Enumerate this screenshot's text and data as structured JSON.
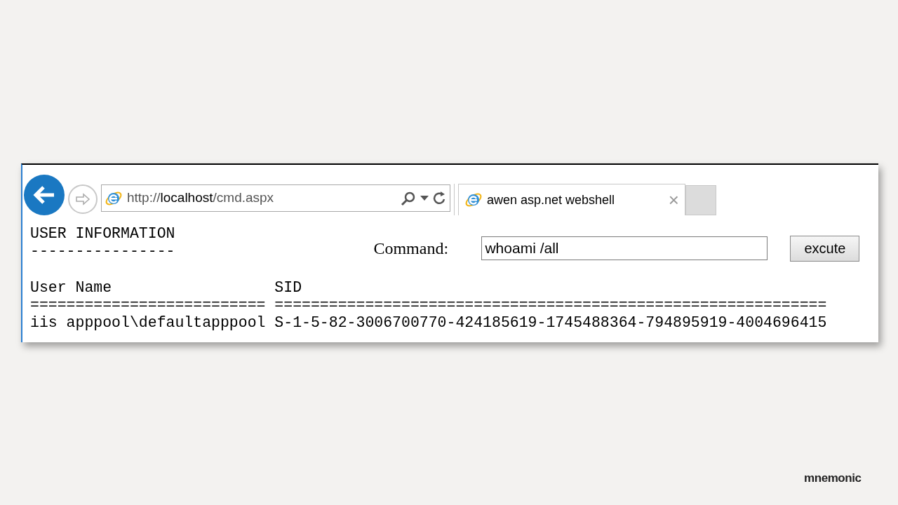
{
  "browser": {
    "address": {
      "prefix": "http://",
      "host": "localhost",
      "path": "/cmd.aspx"
    },
    "tabs": [
      {
        "title": "awen asp.net webshell",
        "close": "×",
        "selected": true
      }
    ]
  },
  "page": {
    "heading_lines": [
      "USER INFORMATION",
      "----------------"
    ],
    "command": {
      "label": "Command:",
      "value": "whoami /all",
      "button": "excute"
    },
    "table_lines": [
      "User Name                  SID",
      "========================== =============================================================",
      "iis apppool\\defaultapppool S-1-5-82-3006700770-424185619-1745488364-794895919-4004696415"
    ]
  },
  "slide": {
    "logo": "mnemonic"
  }
}
